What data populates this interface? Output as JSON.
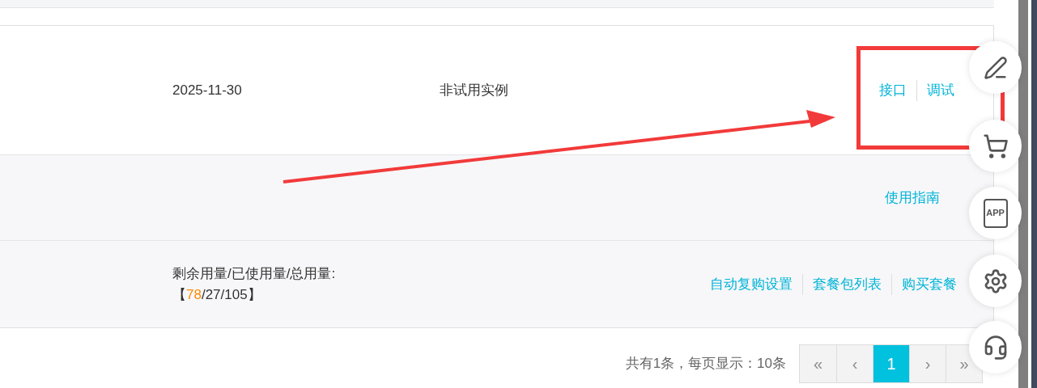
{
  "rows": [
    {
      "kind": "instance",
      "date": "2025-11-30",
      "status": "非试用实例",
      "links": [
        "接口",
        "调试"
      ]
    },
    {
      "kind": "guide",
      "links": [
        "使用指南"
      ]
    },
    {
      "kind": "usage",
      "usage": {
        "label": "剩余用量/已使用量/总用量:",
        "open": "【",
        "remaining": "78",
        "rest": "/27/105",
        "close": "】"
      },
      "links": [
        "自动复购设置",
        "套餐包列表",
        "购买套餐"
      ]
    }
  ],
  "pagination": {
    "summary": "共有1条，每页显示：10条",
    "pages": [
      {
        "label": "«",
        "selected": false
      },
      {
        "label": "‹",
        "selected": false
      },
      {
        "label": "1",
        "selected": true
      },
      {
        "label": "›",
        "selected": false
      },
      {
        "label": "»",
        "selected": false
      }
    ]
  },
  "side_buttons": [
    {
      "kind": "edit"
    },
    {
      "kind": "cart"
    },
    {
      "kind": "app",
      "label": "APP"
    },
    {
      "kind": "settings"
    },
    {
      "kind": "support"
    }
  ]
}
